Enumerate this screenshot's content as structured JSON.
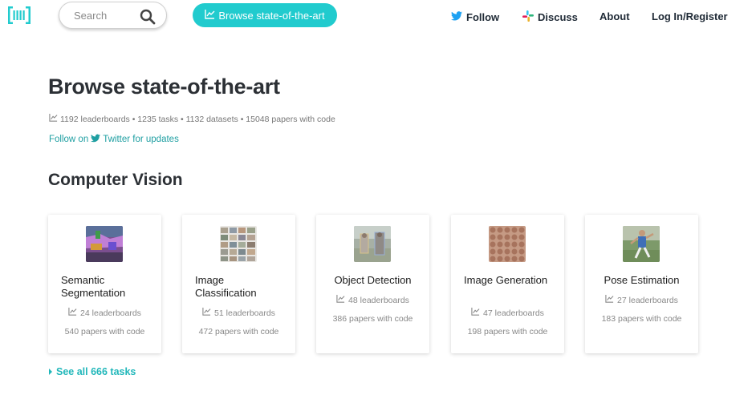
{
  "nav": {
    "search_placeholder": "Search",
    "browse_label": "Browse state-of-the-art",
    "follow_label": "Follow",
    "discuss_label": "Discuss",
    "about_label": "About",
    "login_label": "Log In/Register",
    "accent_color": "#21cbce"
  },
  "header": {
    "title": "Browse state-of-the-art",
    "stats": "1192 leaderboards • 1235 tasks • 1132 datasets • 15048 papers with code",
    "follow_prefix": "Follow on",
    "follow_suffix": "Twitter for updates"
  },
  "section": {
    "title": "Computer Vision",
    "see_all": "See all 666 tasks"
  },
  "cards": [
    {
      "name": "Semantic Segmentation",
      "leaderboards": "24 leaderboards",
      "papers": "540 papers with code",
      "icon": "segmentation-thumbnail"
    },
    {
      "name": "Image Classification",
      "leaderboards": "51 leaderboards",
      "papers": "472 papers with code",
      "icon": "classification-thumbnail"
    },
    {
      "name": "Object Detection",
      "leaderboards": "48 leaderboards",
      "papers": "386 papers with code",
      "icon": "detection-thumbnail"
    },
    {
      "name": "Image Generation",
      "leaderboards": "47 leaderboards",
      "papers": "198 papers with code",
      "icon": "generation-thumbnail"
    },
    {
      "name": "Pose Estimation",
      "leaderboards": "27 leaderboards",
      "papers": "183 papers with code",
      "icon": "pose-thumbnail"
    }
  ]
}
